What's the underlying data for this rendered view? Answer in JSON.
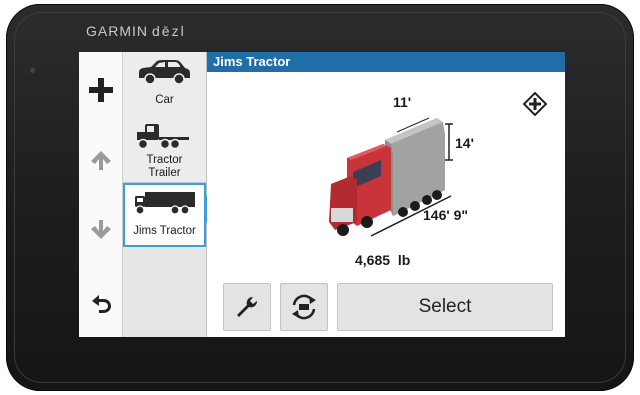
{
  "device": {
    "brand": "GARMIN",
    "model": "dēzl"
  },
  "header": {
    "title": "Jims Tractor"
  },
  "vehicles": [
    {
      "label": "Car",
      "icon": "car-icon"
    },
    {
      "label": "Tractor\nTrailer",
      "icon": "tractor-trailer-icon"
    },
    {
      "label": "Jims Tractor",
      "icon": "jims-tractor-icon",
      "selected": true
    }
  ],
  "sidebar": {
    "add_icon": "plus-icon",
    "up_icon": "arrow-up-icon",
    "down_icon": "arrow-down-icon",
    "back_icon": "back-arrow-icon"
  },
  "dimensions": {
    "width": "11'",
    "height": "14'",
    "length": "146' 9\"",
    "weight": "4,685  lb"
  },
  "toolbar": {
    "settings_icon": "wrench-icon",
    "swap_icon": "swap-vehicle-icon",
    "select_label": "Select"
  },
  "colors": {
    "header": "#1f6ea8",
    "selection": "#39a0d8",
    "truck_cab": "#c9343a",
    "trailer": "#9a9a9a"
  }
}
